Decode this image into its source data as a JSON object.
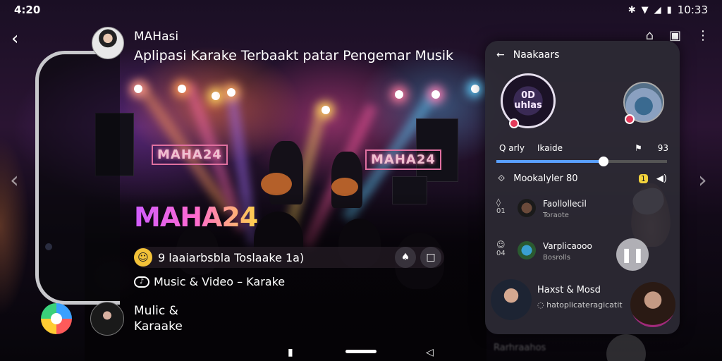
{
  "status_bar": {
    "time_left": "4:20",
    "time_right": "10:33",
    "icons": [
      "notification-icon",
      "wifi-icon",
      "signal-icon",
      "battery-icon"
    ]
  },
  "video": {
    "channel_name": "MAHasi",
    "title": "Aplipasi Karake Terbaakt patar Pengemar Musik",
    "logo_text": "MAHA24",
    "stage_signs": [
      "MAHA24",
      "MAHA24"
    ],
    "info_line": "9 laaiarbsbla Toslaake 1a)",
    "category": "Music & Video – Karake",
    "side_label_line1": "Mulic &",
    "side_label_line2": "Karaake"
  },
  "panel": {
    "header": "Naakaars",
    "album_art_text": "0D\nuhlas",
    "tab_left": "Q arly",
    "tab_right": "Ikaide",
    "tab_count": "93",
    "progress_percent": 63,
    "section_title": "Mookalyler 80",
    "items": [
      {
        "glyph": "◊",
        "num": "01",
        "title": "Faollollecil",
        "sub": "Toraote"
      },
      {
        "glyph": "☺",
        "num": "04",
        "title": "Varplicaooo",
        "sub": "Bosrolls"
      }
    ],
    "bottom_title": "Haxst & Mosd",
    "bottom_sub": "hatoplicateragicatit"
  },
  "nav": {
    "under_text": "Rarhraahos"
  },
  "colors": {
    "accent": "#5aa0ff",
    "badge": "#e23a5a",
    "logo_gradient": [
      "#d05cff",
      "#ff6ad0",
      "#ffd24a"
    ]
  }
}
